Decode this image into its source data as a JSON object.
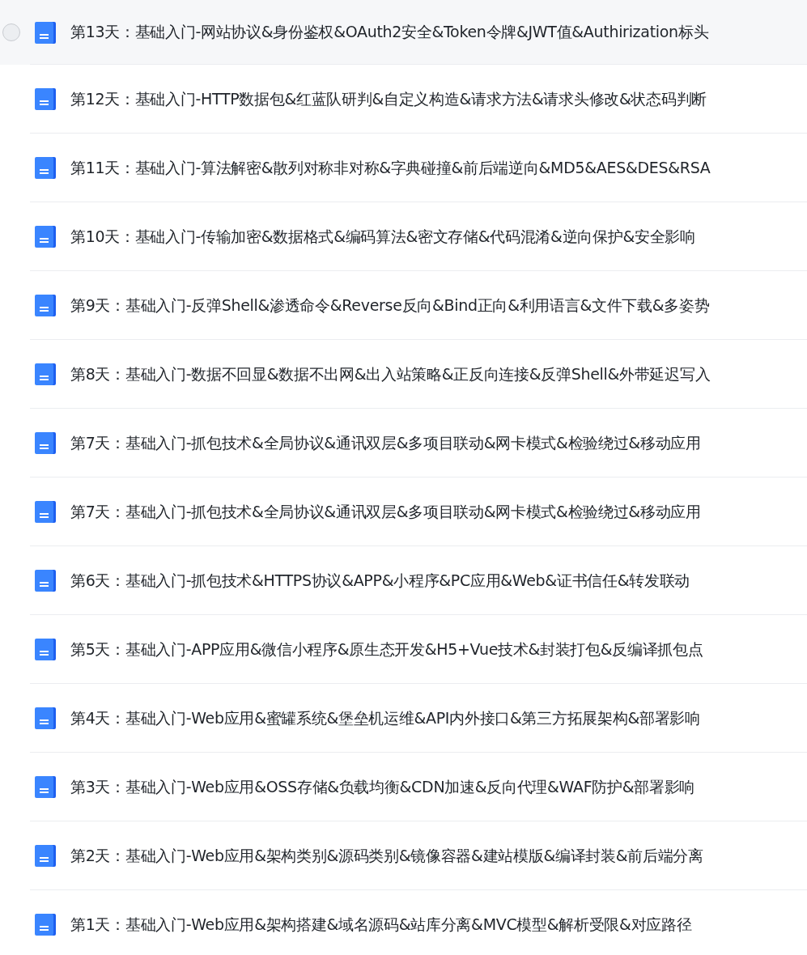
{
  "files": [
    {
      "title": "第13天：基础入门-网站协议&身份鉴权&OAuth2安全&Token令牌&JWT值&Authirization标头",
      "hovered": true
    },
    {
      "title": "第12天：基础入门-HTTP数据包&红蓝队研判&自定义构造&请求方法&请求头修改&状态码判断",
      "hovered": false
    },
    {
      "title": "第11天：基础入门-算法解密&散列对称非对称&字典碰撞&前后端逆向&MD5&AES&DES&RSA",
      "hovered": false
    },
    {
      "title": "第10天：基础入门-传输加密&数据格式&编码算法&密文存储&代码混淆&逆向保护&安全影响",
      "hovered": false
    },
    {
      "title": "第9天：基础入门-反弹Shell&渗透命令&Reverse反向&Bind正向&利用语言&文件下载&多姿势",
      "hovered": false
    },
    {
      "title": "第8天：基础入门-数据不回显&数据不出网&出入站策略&正反向连接&反弹Shell&外带延迟写入",
      "hovered": false
    },
    {
      "title": "第7天：基础入门-抓包技术&全局协议&通讯双层&多项目联动&网卡模式&检验绕过&移动应用",
      "hovered": false
    },
    {
      "title": "第7天：基础入门-抓包技术&全局协议&通讯双层&多项目联动&网卡模式&检验绕过&移动应用",
      "hovered": false
    },
    {
      "title": "第6天：基础入门-抓包技术&HTTPS协议&APP&小程序&PC应用&Web&证书信任&转发联动",
      "hovered": false
    },
    {
      "title": "第5天：基础入门-APP应用&微信小程序&原生态开发&H5+Vue技术&封装打包&反编译抓包点",
      "hovered": false
    },
    {
      "title": "第4天：基础入门-Web应用&蜜罐系统&堡垒机运维&API内外接口&第三方拓展架构&部署影响",
      "hovered": false
    },
    {
      "title": "第3天：基础入门-Web应用&OSS存储&负载均衡&CDN加速&反向代理&WAF防护&部署影响",
      "hovered": false
    },
    {
      "title": "第2天：基础入门-Web应用&架构类别&源码类别&镜像容器&建站模版&编译封装&前后端分离",
      "hovered": false
    },
    {
      "title": "第1天：基础入门-Web应用&架构搭建&域名源码&站库分离&MVC模型&解析受限&对应路径",
      "hovered": false
    }
  ]
}
